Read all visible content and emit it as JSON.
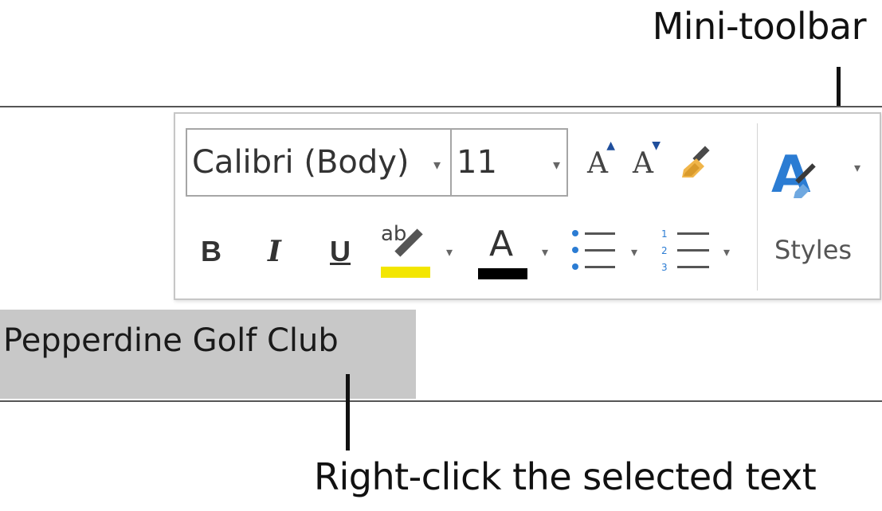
{
  "callouts": {
    "top": "Mini-toolbar",
    "bottom": "Right-click the selected text"
  },
  "document": {
    "selected_text": "Pepperdine Golf Club"
  },
  "mini_toolbar": {
    "font_name": "Calibri (Body)",
    "font_size": "11",
    "dropdown_arrow": "▾",
    "grow_font_label": "A",
    "shrink_font_label": "A",
    "bold_label": "B",
    "italic_label": "I",
    "underline_label": "U",
    "highlight_label": "ab",
    "font_color_label": "A",
    "styles_label": "Styles",
    "highlight_color": "#f3e600",
    "font_color": "#000000",
    "accent_blue": "#2b7cd3"
  }
}
